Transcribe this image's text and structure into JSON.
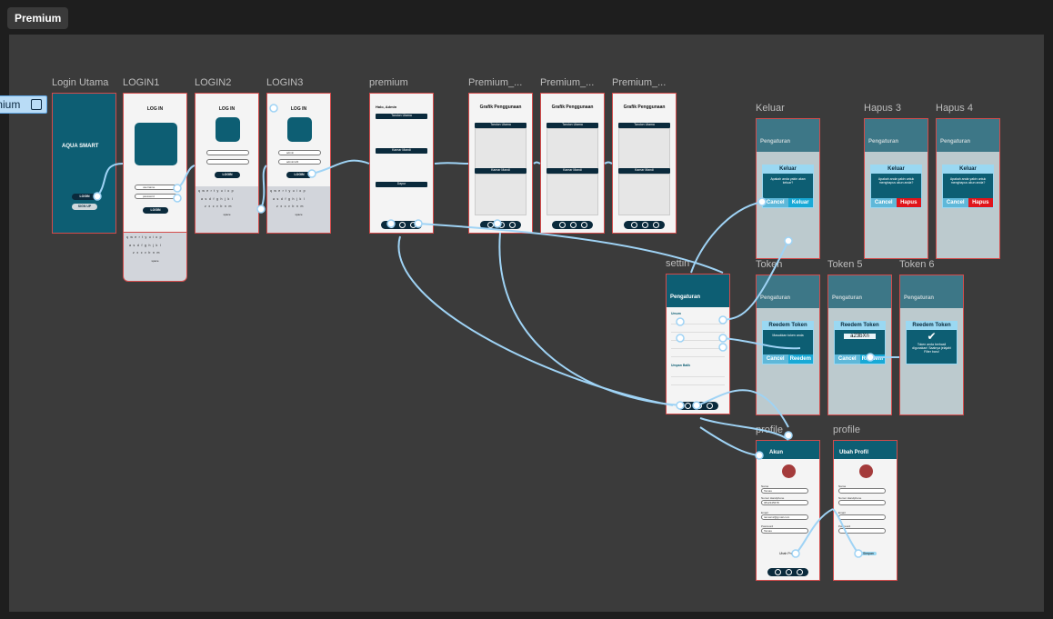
{
  "page_tab": "Premium",
  "section_label": "mium",
  "frames": {
    "login_utama": "Login Utama",
    "login1": "LOGIN1",
    "login2": "LOGIN2",
    "login3": "LOGIN3",
    "premium": "premium",
    "premium_a": "Premium_...",
    "premium_b": "Premium_...",
    "premium_c": "Premium_...",
    "keluar": "Keluar",
    "hapus3": "Hapus 3",
    "hapus4": "Hapus 4",
    "setting": "settin",
    "token": "Token",
    "token5": "Token 5",
    "token6": "Token 6",
    "profile": "profile",
    "profile2": "profile"
  },
  "phone": {
    "time": "9:41",
    "app_name": "AQUA SMART",
    "login_btn": "LOGIN",
    "signup_btn": "SIGN UP",
    "login_title": "LOG IN",
    "username_ph": "username",
    "password_ph": "password",
    "admin_value": "admin",
    "pass_value": "admin123",
    "kb_row1": "qwertyuiop",
    "kb_row2": "asdfghjkl",
    "kb_row3": "zxcvbnm",
    "kb_space": "space",
    "kb_return": "return",
    "kb_123": "123"
  },
  "premium": {
    "greeting": "Halo, Admin",
    "panels": [
      "Tandon Utama",
      "Kamar Mandi",
      "Dapur"
    ],
    "chart_title": "Grafik Penggunaan",
    "chart_sections": [
      "Tandon Utama",
      "Kamar Mandi",
      "Dapur"
    ]
  },
  "settings": {
    "title": "Pengaturan",
    "umum": "Umum",
    "umpan_balik": "Umpan Balik",
    "keluar_title": "Keluar",
    "keluar_msg": "Apakah anda yakin akan keluar?",
    "cancel": "Cancel",
    "keluar_btn": "Keluar",
    "hapus_msg": "Apakah anda yakin untuk menghapus akun anda?",
    "hapus_btn": "Hapus",
    "redeem_title": "Reedem Token",
    "redeem_msg": "Masukkan token anda",
    "redeem_btn": "Reedem",
    "token_value": "a23bXn",
    "token_done": "Token anda berhasil digunakan! Saatnya jelajahi Filter baru!"
  },
  "profile": {
    "akun": "Akun",
    "ubah_profil": "Ubah Profil",
    "nama_label": "Nama",
    "nama": "Tamas",
    "telp_label": "Nomor Handphone",
    "telp": "0812345678",
    "email_label": "Email",
    "email": "tamas12@gmail.com",
    "pw_label": "Password",
    "pw": "Tamas",
    "ubah_btn": "Ubah Profil",
    "simpan_btn": "Simpan"
  }
}
